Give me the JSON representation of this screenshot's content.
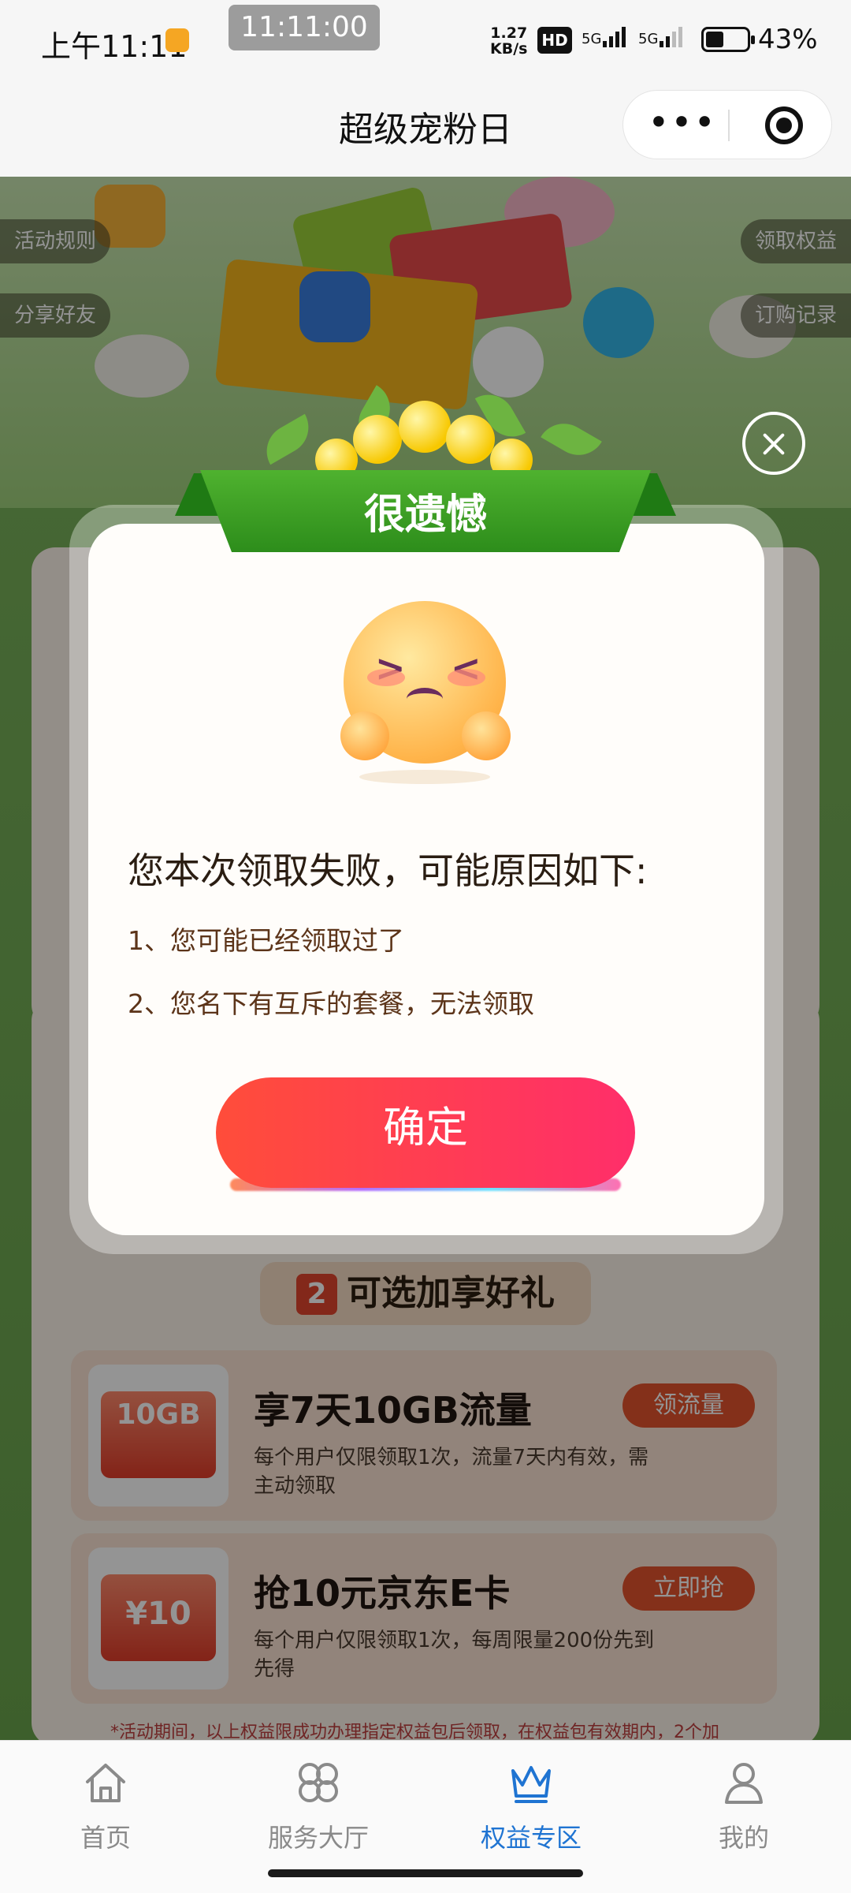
{
  "status_bar": {
    "time": "上午11:11",
    "center_clock": "11:11:00",
    "net_speed_value": "1.27",
    "net_speed_unit": "KB/s",
    "hd_badge": "HD",
    "signal_1_label": "5G",
    "signal_2_label": "5G",
    "battery_percent": "43%",
    "battery_level": 0.43
  },
  "title_bar": {
    "title": "超级宠粉日",
    "more_icon": "more-dots-icon",
    "close_icon": "target-close-icon"
  },
  "page": {
    "side_links": {
      "rules": "活动规则",
      "share": "分享好友",
      "claim": "领取权益",
      "orders": "订购记录"
    },
    "section2": {
      "number": "2",
      "title": "可选加享好礼"
    },
    "offers": [
      {
        "thumb_text": "10GB",
        "title": "享7天10GB流量",
        "desc": "每个用户仅限领取1次，流量7天内有效，需主动领取",
        "button": "领流量"
      },
      {
        "thumb_text": "¥10",
        "title": "抢10元京东E卡",
        "desc": "每个用户仅限领取1次，每周限量200份先到先得",
        "button": "立即抢"
      }
    ],
    "footnote": "*活动期间，以上权益限成功办理指定权益包后领取，在权益包有效期内，2个加"
  },
  "modal": {
    "header": "很遗憾",
    "message_title": "您本次领取失败，可能原因如下:",
    "reasons": [
      "1、您可能已经领取过了",
      "2、您名下有互斥的套餐，无法领取"
    ],
    "confirm_label": "确定",
    "close_icon": "close-circle-icon",
    "mascot": "sad-face-mascot",
    "colors": {
      "ribbon": "#3b9e24",
      "button_start": "#ff4d3a",
      "button_end": "#ff2e6a"
    }
  },
  "bottom_nav": {
    "items": [
      {
        "label": "首页",
        "icon": "home-icon",
        "active": false
      },
      {
        "label": "服务大厅",
        "icon": "clover-icon",
        "active": false
      },
      {
        "label": "权益专区",
        "icon": "crown-icon",
        "active": true
      },
      {
        "label": "我的",
        "icon": "person-icon",
        "active": false
      }
    ],
    "active_color": "#1f74d2"
  }
}
